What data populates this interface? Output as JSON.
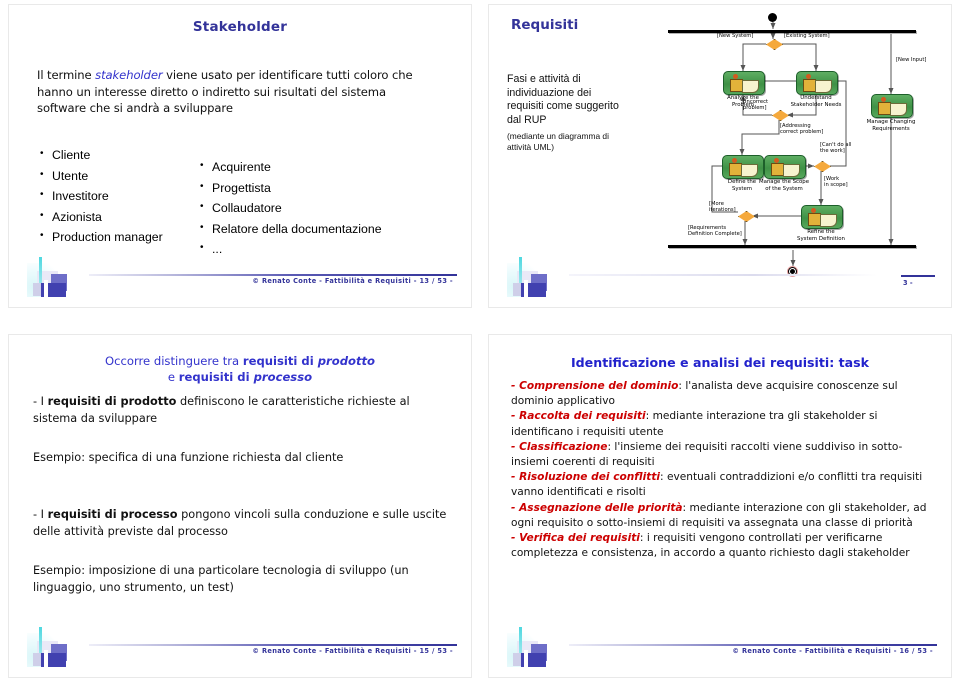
{
  "slides": [
    {
      "id": "slide-stakeholder",
      "title": "Stakeholder",
      "paragraph_pre": "Il termine ",
      "paragraph_em": "stakeholder",
      "paragraph_post": " viene usato per identificare tutti coloro che hanno un interesse diretto o indiretto sui risultati del sistema software che si andrà a sviluppare",
      "list_left": [
        "Cliente",
        "Utente",
        "Investitore",
        "Azionista",
        "Production manager"
      ],
      "list_right": [
        "Acquirente",
        "Progettista",
        "Collaudatore",
        "Relatore della documentazione",
        "..."
      ],
      "footer": "© Renato Conte - Fattibilità e Requisiti - 13 / 53 -"
    },
    {
      "id": "slide-requisiti",
      "title": "Requisiti",
      "text": "Fasi e attività di individuazione dei requisiti come suggerito dal RUP",
      "subtext": "(mediante un diagramma di attività UML)",
      "page_number": "3 -"
    },
    {
      "id": "slide-prodotto-processo",
      "title_line1_a": "Occorre distinguere tra ",
      "title_line1_b": "requisiti di ",
      "title_line1_c": "prodotto",
      "title_line2_a": "e ",
      "title_line2_b": "requisiti di ",
      "title_line2_c": "processo",
      "p1_a": "- I ",
      "p1_b": "requisiti di prodotto",
      "p1_c": " definiscono le caratteristiche richieste al sistema da sviluppare",
      "p2": "Esempio: specifica di una funzione richiesta dal cliente",
      "p3_a": "- I ",
      "p3_b": "requisiti di processo",
      "p3_c": " pongono vincoli sulla conduzione e sulle uscite delle attività previste dal processo",
      "p4": "Esempio: imposizione di una particolare tecnologia di sviluppo (un linguaggio, uno strumento, un test)",
      "footer": "© Renato Conte - Fattibilità e Requisiti - 15 / 53 -"
    },
    {
      "id": "slide-task",
      "title": "Identificazione e analisi dei requisiti: task",
      "tasks": [
        {
          "lead": "- Comprensione del dominio",
          "body": ": l'analista deve acquisire conoscenze sul dominio applicativo"
        },
        {
          "lead": "- Raccolta dei requisiti",
          "body": ": mediante interazione tra gli stakeholder si identificano i requisiti utente"
        },
        {
          "lead": "- Classificazione",
          "body": ": l'insieme dei requisiti raccolti viene suddiviso in sotto-insiemi coerenti di requisiti"
        },
        {
          "lead": "- Risoluzione dei conflitti",
          "body": ": eventuali contraddizioni e/o conflitti tra requisiti vanno identificati e risolti"
        },
        {
          "lead": "- Assegnazione delle priorità",
          "body": ": mediante interazione con gli stakeholder, ad ogni requisito o sotto-insiemi di requisiti va assegnata una classe di priorità"
        },
        {
          "lead": "- Verifica dei requisiti",
          "body": ": i requisiti vengono controllati per verificarne completezza e consistenza, in accordo a quanto richiesto dagli stakeholder"
        }
      ],
      "footer": "© Renato Conte - Fattibilità e Requisiti - 16 / 53 -"
    }
  ],
  "diagram": {
    "type": "uml-activity-diagram",
    "activities": [
      {
        "id": "analyze-the-problem",
        "label": "Analyze the\nProblem"
      },
      {
        "id": "understand-stakeholder-needs",
        "label": "Understand\nStakeholder Needs"
      },
      {
        "id": "manage-changing-requirements",
        "label": "Manage Changing\nRequirements"
      },
      {
        "id": "define-the-system",
        "label": "Define the\nSystem"
      },
      {
        "id": "manage-the-scope-of-the-system",
        "label": "Manage the Scope\nof the System"
      },
      {
        "id": "refine-the-system-definition",
        "label": "Refine the\nSystem Definition"
      }
    ],
    "guards": [
      {
        "id": "guard-new-system",
        "text": "[New System]"
      },
      {
        "id": "guard-existing-system",
        "text": "[Existing System]"
      },
      {
        "id": "guard-new-input",
        "text": "[New Input]"
      },
      {
        "id": "guard-incorrect-problem",
        "text": "[Incorrect\nproblem]"
      },
      {
        "id": "guard-addressing-correct-problem",
        "text": "[Addressing\ncorrect problem]"
      },
      {
        "id": "guard-cant-do-all-the-work",
        "text": "[Can't do all\nthe work]"
      },
      {
        "id": "guard-work-in-scope",
        "text": "[Work\nin scope]"
      },
      {
        "id": "guard-more-iterations",
        "text": "[More\niterations]"
      },
      {
        "id": "guard-requirements-definition-complete",
        "text": "[Requirements\nDefinition Complete]"
      }
    ]
  },
  "colors": {
    "title_blue": "#333399",
    "accent_blue": "#3333cc",
    "task_red": "#cc0000",
    "activity_green": "#3f9146",
    "decision_orange": "#f5a93c"
  }
}
